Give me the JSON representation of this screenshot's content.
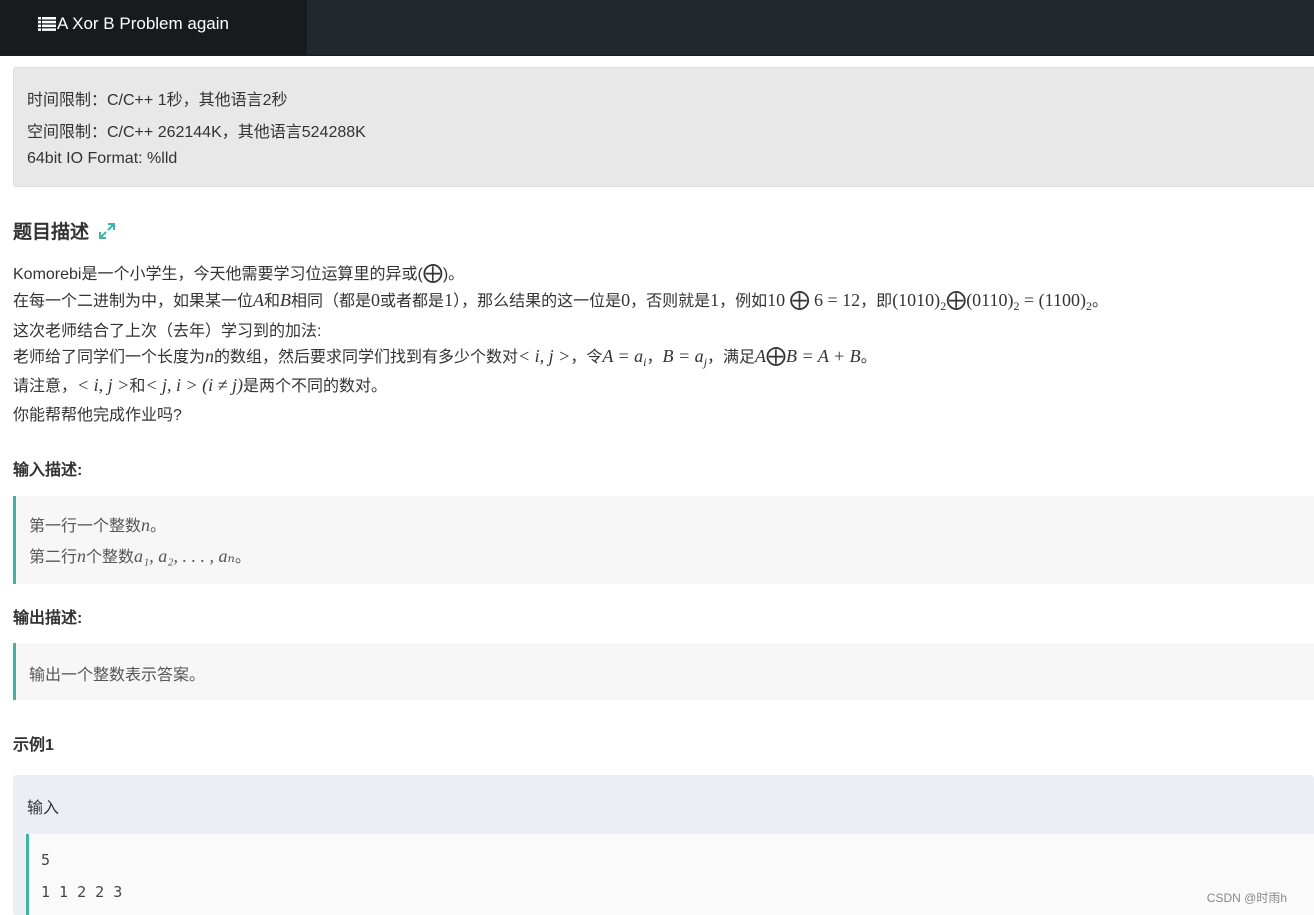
{
  "header": {
    "title": "A Xor B Problem again"
  },
  "limits": {
    "time": "时间限制：C/C++ 1秒，其他语言2秒",
    "space": "空间限制：C/C++ 262144K，其他语言524288K",
    "format": "64bit IO Format: %lld"
  },
  "description": {
    "heading": "题目描述",
    "l1": {
      "a": "Komorebi是一个小学生，今天他需要学习位运算里的异或(",
      "op": "⨁",
      "b": ")。"
    },
    "l2": {
      "a": "在每一个二进制为中，如果某一位",
      "A": "A",
      "b": "和",
      "B": "B",
      "c": "相同（都是",
      "zero": "0",
      "d": "或者都是",
      "one": "1",
      "e": "），那么结果的这一位是",
      "zero2": "0",
      "f": "，否则就是",
      "one2": "1",
      "g": "，例如",
      "ex1": "10",
      "op": "⨁",
      "ex2": "6 = 12",
      "h": "，即",
      "b1": "(1010)",
      "sub": "2",
      "b2": "(0110)",
      "eq": " = (1100)",
      "i": "。"
    },
    "l3": "这次老师结合了上次（去年）学习到的加法:",
    "l4": {
      "a": "老师给了同学们一个长度为",
      "n": "n",
      "b": "的数组，然后要求同学们找到有多少个数对",
      "pair": "< i, j >",
      "c": "，令",
      "A": "A = a",
      "ai": "i",
      "d": "，",
      "B": "B = a",
      "aj": "j",
      "e": "，满足",
      "f1": "A",
      "op": "⨁",
      "f2": "B = A + B",
      "g": "。"
    },
    "l5": {
      "a": "请注意，",
      "p1": "< i, j >",
      "b": "和",
      "p2": "< j, i > (i ≠ j)",
      "c": "是两个不同的数对。"
    },
    "l6": "你能帮帮他完成作业吗?"
  },
  "input": {
    "heading": "输入描述:",
    "l1": {
      "a": "第一行一个整数",
      "n": "n",
      "b": "。"
    },
    "l2": {
      "a": "第二行",
      "n": "n",
      "b": "个整数",
      "seq": "a₁, a₂, . . . , aₙ",
      "c": "。"
    }
  },
  "output": {
    "heading": "输出描述:",
    "l1": "输出一个整数表示答案。"
  },
  "example": {
    "heading": "示例1",
    "input_label": "输入",
    "line1": "5",
    "line2": "1 1 2 2 3"
  },
  "watermark": "CSDN @时雨h",
  "colors": {
    "topbar": "#23282c",
    "accent": "#3cb4a6"
  }
}
